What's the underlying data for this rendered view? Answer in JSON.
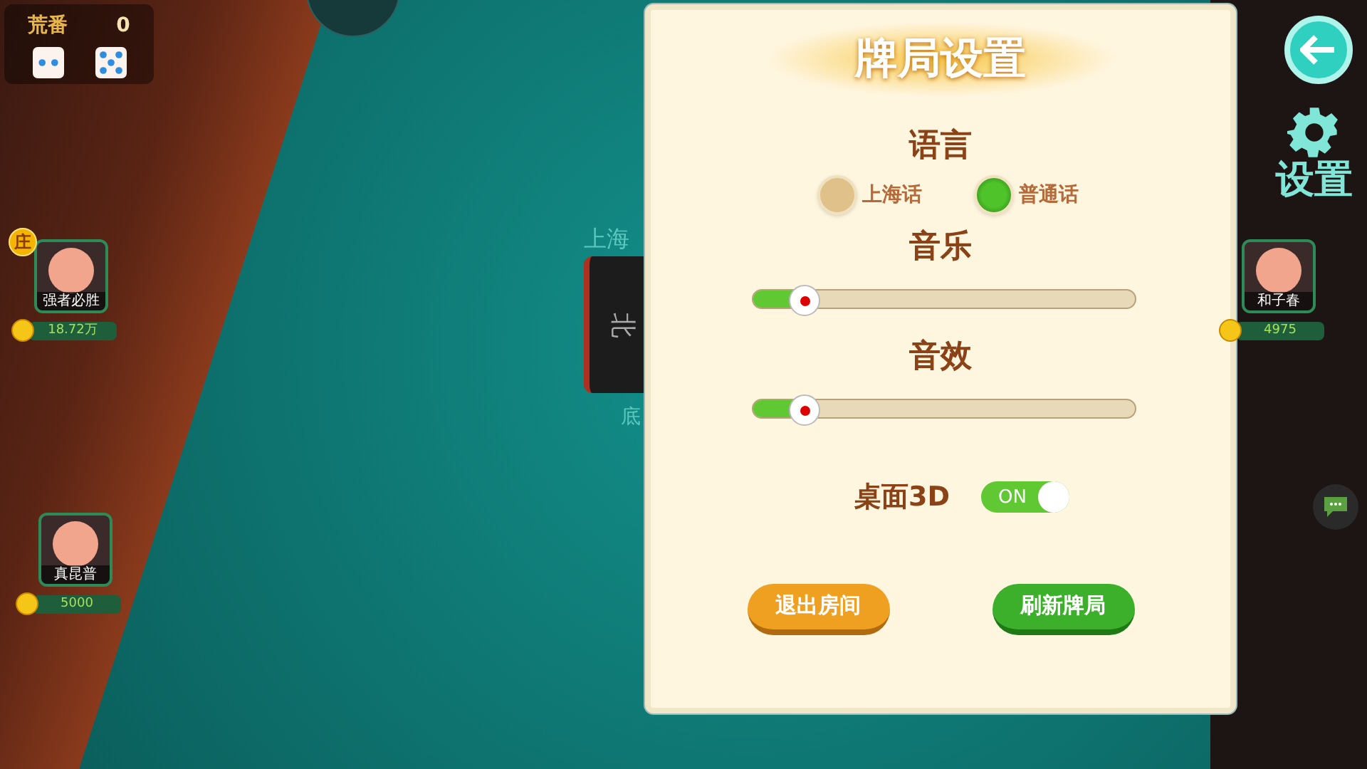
{
  "round_info": {
    "label": "荒番",
    "value": "0",
    "dice": [
      {
        "kind": "two"
      },
      {
        "kind": "five"
      }
    ]
  },
  "players": [
    {
      "name": "强者必胜",
      "coins": "18.72万",
      "dealer_badge": "庄"
    },
    {
      "name": "真昆普",
      "coins": "5000"
    },
    {
      "name": "和子春",
      "coins": "4975"
    }
  ],
  "table": {
    "labels": [
      "上海",
      "底"
    ],
    "tile": "北"
  },
  "settings_panel": {
    "title": "牌局设置",
    "language": {
      "label": "语言",
      "options": [
        {
          "label": "上海话",
          "selected": false
        },
        {
          "label": "普通话",
          "selected": true
        }
      ]
    },
    "music": {
      "label": "音乐",
      "level": 0.14
    },
    "effects": {
      "label": "音效",
      "level": 0.14
    },
    "table_3d": {
      "label": "桌面3D",
      "on": true,
      "state_text": "ON"
    },
    "buttons": [
      {
        "label": "退出房间",
        "kind": "exit"
      },
      {
        "label": "刷新牌局",
        "kind": "refresh"
      }
    ]
  },
  "side_menu": {
    "settings_label": "设置"
  }
}
